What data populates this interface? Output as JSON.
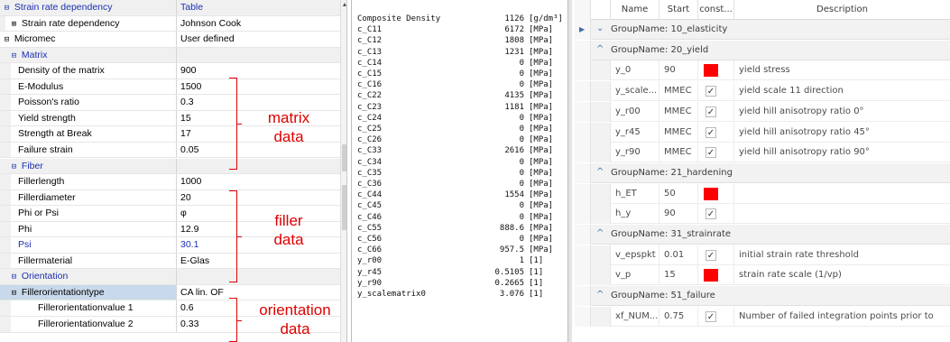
{
  "property_grid": {
    "rows": [
      {
        "level": 0,
        "toggle": "⊟",
        "name": "Strain rate dependency",
        "value": "Table",
        "category": true
      },
      {
        "level": 1,
        "toggle": "⊞",
        "name": "Strain rate dependency",
        "value": "Johnson Cook",
        "category": false
      },
      {
        "level": 0,
        "toggle": "⊟",
        "name": "Micromec",
        "value": "User defined",
        "category": false
      },
      {
        "level": 1,
        "toggle": "⊟",
        "name": "Matrix",
        "value": "",
        "category": true
      },
      {
        "level": 2,
        "toggle": "",
        "name": "Density of the matrix",
        "value": "900",
        "category": false
      },
      {
        "level": 2,
        "toggle": "",
        "name": "E-Modulus",
        "value": "1500",
        "category": false
      },
      {
        "level": 2,
        "toggle": "",
        "name": "Poisson's ratio",
        "value": "0.3",
        "category": false
      },
      {
        "level": 2,
        "toggle": "",
        "name": "Yield strength",
        "value": "15",
        "category": false
      },
      {
        "level": 2,
        "toggle": "",
        "name": "Strength at Break",
        "value": "17",
        "category": false
      },
      {
        "level": 2,
        "toggle": "",
        "name": "Failure strain",
        "value": "0.05",
        "category": false
      },
      {
        "level": 1,
        "toggle": "⊟",
        "name": "Fiber",
        "value": "",
        "category": true
      },
      {
        "level": 2,
        "toggle": "",
        "name": "Fillerlength",
        "value": "1000",
        "category": false
      },
      {
        "level": 2,
        "toggle": "",
        "name": "Fillerdiameter",
        "value": "20",
        "category": false
      },
      {
        "level": 2,
        "toggle": "",
        "name": "Phi or Psi",
        "value": "φ",
        "category": false
      },
      {
        "level": 2,
        "toggle": "",
        "name": "Phi",
        "value": "12.9",
        "category": false
      },
      {
        "level": 2,
        "toggle": "",
        "name": "Psi",
        "value": "30.1",
        "category": false,
        "blue": true
      },
      {
        "level": 2,
        "toggle": "",
        "name": "Fillermaterial",
        "value": "E-Glas",
        "category": false
      },
      {
        "level": 1,
        "toggle": "⊟",
        "name": "Orientation",
        "value": "",
        "category": true
      },
      {
        "level": 1,
        "toggle": "⊟",
        "name": "Fillerorientationtype",
        "value": "CA lin. OF",
        "category": false,
        "selected": true
      },
      {
        "level": 3,
        "toggle": "",
        "name": "Fillerorientationvalue 1",
        "value": "0.6",
        "category": false
      },
      {
        "level": 3,
        "toggle": "",
        "name": "Fillerorientationvalue 2",
        "value": "0.33",
        "category": false
      }
    ],
    "scroll_arrow": "▲"
  },
  "annotations": [
    {
      "line1": "matrix",
      "line2": "data"
    },
    {
      "line1": "filler",
      "line2": "data"
    },
    {
      "line1": "orientation",
      "line2": "data"
    }
  ],
  "text_output": {
    "lines": [
      {
        "name": "Composite Density",
        "value": "1126",
        "unit": "[g/dm³]"
      },
      {
        "name": "c_C11",
        "value": "6172",
        "unit": "[MPa]"
      },
      {
        "name": "c_C12",
        "value": "1808",
        "unit": "[MPa]"
      },
      {
        "name": "c_C13",
        "value": "1231",
        "unit": "[MPa]"
      },
      {
        "name": "c_C14",
        "value": "0",
        "unit": "[MPa]"
      },
      {
        "name": "c_C15",
        "value": "0",
        "unit": "[MPa]"
      },
      {
        "name": "c_C16",
        "value": "0",
        "unit": "[MPa]"
      },
      {
        "name": "c_C22",
        "value": "4135",
        "unit": "[MPa]"
      },
      {
        "name": "c_C23",
        "value": "1181",
        "unit": "[MPa]"
      },
      {
        "name": "c_C24",
        "value": "0",
        "unit": "[MPa]"
      },
      {
        "name": "c_C25",
        "value": "0",
        "unit": "[MPa]"
      },
      {
        "name": "c_C26",
        "value": "0",
        "unit": "[MPa]"
      },
      {
        "name": "c_C33",
        "value": "2616",
        "unit": "[MPa]"
      },
      {
        "name": "c_C34",
        "value": "0",
        "unit": "[MPa]"
      },
      {
        "name": "c_C35",
        "value": "0",
        "unit": "[MPa]"
      },
      {
        "name": "c_C36",
        "value": "0",
        "unit": "[MPa]"
      },
      {
        "name": "c_C44",
        "value": "1554",
        "unit": "[MPa]"
      },
      {
        "name": "c_C45",
        "value": "0",
        "unit": "[MPa]"
      },
      {
        "name": "c_C46",
        "value": "0",
        "unit": "[MPa]"
      },
      {
        "name": "c_C55",
        "value": "888.6",
        "unit": "[MPa]"
      },
      {
        "name": "c_C56",
        "value": "0",
        "unit": "[MPa]"
      },
      {
        "name": "c_C66",
        "value": "957.5",
        "unit": "[MPa]"
      },
      {
        "name": "y_r00",
        "value": "1",
        "unit": "[1]"
      },
      {
        "name": "y_r45",
        "value": "0.5105",
        "unit": "[1]"
      },
      {
        "name": "y_r90",
        "value": "0.2665",
        "unit": "[1]"
      },
      {
        "name": "y_scalematrix0",
        "value": "3.076",
        "unit": "[1]"
      }
    ]
  },
  "data_grid": {
    "columns": {
      "name": "Name",
      "start": "Start",
      "const": "const...",
      "description": "Description"
    },
    "rows": [
      {
        "type": "group",
        "label": "GroupName: 10_elasticity",
        "chevron": "⌄",
        "current": true
      },
      {
        "type": "group",
        "label": "GroupName: 20_yield",
        "chevron": "^"
      },
      {
        "type": "data",
        "name": "y_0",
        "start": "90",
        "const": "red",
        "description": "yield stress"
      },
      {
        "type": "data",
        "name": "y_scale...",
        "start": "MMEC",
        "const": "check",
        "description": "yield scale 11 direction"
      },
      {
        "type": "data",
        "name": "y_r00",
        "start": "MMEC",
        "const": "check",
        "description": "yield hill anisotropy ratio 0°"
      },
      {
        "type": "data",
        "name": "y_r45",
        "start": "MMEC",
        "const": "check",
        "description": "yield hill anisotropy ratio 45°"
      },
      {
        "type": "data",
        "name": "y_r90",
        "start": "MMEC",
        "const": "check",
        "description": "yield hill anisotropy ratio 90°"
      },
      {
        "type": "group",
        "label": "GroupName: 21_hardening",
        "chevron": "^"
      },
      {
        "type": "data",
        "name": "h_ET",
        "start": "50",
        "const": "red",
        "description": ""
      },
      {
        "type": "data",
        "name": "h_y",
        "start": "90",
        "const": "check",
        "description": ""
      },
      {
        "type": "group",
        "label": "GroupName: 31_strainrate",
        "chevron": "^"
      },
      {
        "type": "data",
        "name": "v_epspkt",
        "start": "0.01",
        "const": "check",
        "description": "initial strain rate threshold"
      },
      {
        "type": "data",
        "name": "v_p",
        "start": "15",
        "const": "red",
        "description": "strain rate scale (1/vp)"
      },
      {
        "type": "group",
        "label": "GroupName: 51_failure",
        "chevron": "^"
      },
      {
        "type": "data",
        "name": "xf_NUM...",
        "start": "0.75",
        "const": "check",
        "description": "Number of failed integration points prior to"
      }
    ],
    "current_row_marker": "▶",
    "check_glyph": "✓",
    "red_color": "#ff0000"
  }
}
